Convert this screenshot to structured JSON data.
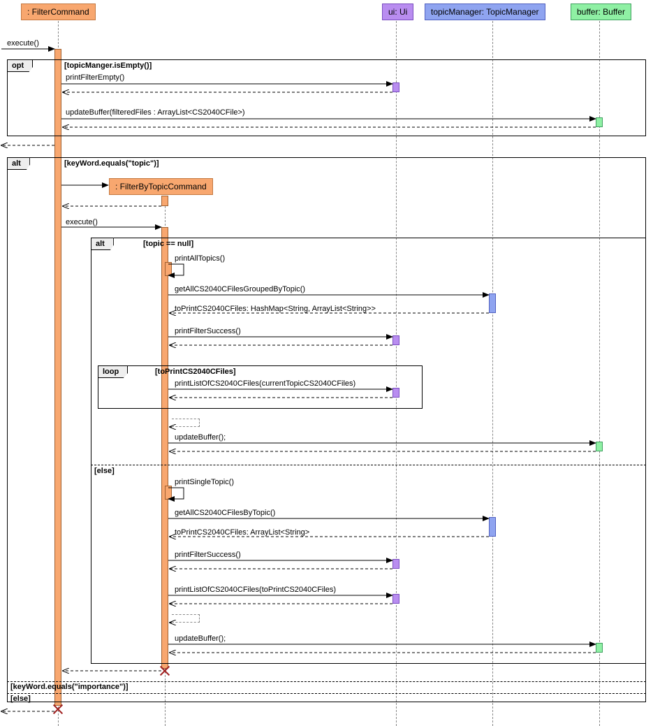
{
  "participants": {
    "filterCommand": ": FilterCommand",
    "filterByTopicCommand": ": FilterByTopicCommand",
    "ui": "ui: Ui",
    "topicManager": "topicManager: TopicManager",
    "buffer": "buffer: Buffer"
  },
  "frames": {
    "opt": "opt",
    "alt1": "alt",
    "alt2": "alt",
    "loop": "loop"
  },
  "guards": {
    "optGuard": "[topicManger.isEmpty()]",
    "alt1a": "[keyWord.equals(\"topic\")]",
    "alt1b": "[keyWord.equals(\"importance\")]",
    "alt1c": "[else]",
    "alt2a": "[topic == null]",
    "alt2b": "[else]",
    "loopGuard": "[toPrintCS2040CFiles]"
  },
  "messages": {
    "m1": "execute()",
    "m2": "printFilterEmpty()",
    "m3": "updateBuffer(filteredFiles : ArrayList<CS2040CFile>)",
    "m4": "execute()",
    "m5": "printAllTopics()",
    "m6": "getAllCS2040CFilesGroupedByTopic()",
    "m7": "toPrintCS2040CFiles: HashMap<String, ArrayList<String>>",
    "m8": "printFilterSuccess()",
    "m9": "printListOfCS2040CFiles(currentTopicCS2040CFiles)",
    "m10": "updateBuffer();",
    "m11": "printSingleTopic()",
    "m12": "getAllCS2040CFilesByTopic()",
    "m13": "toPrintCS2040CFiles: ArrayList<String>",
    "m14": "printFilterSuccess()",
    "m15": "printListOfCS2040CFiles(toPrintCS2040CFiles)",
    "m16": "updateBuffer();"
  }
}
